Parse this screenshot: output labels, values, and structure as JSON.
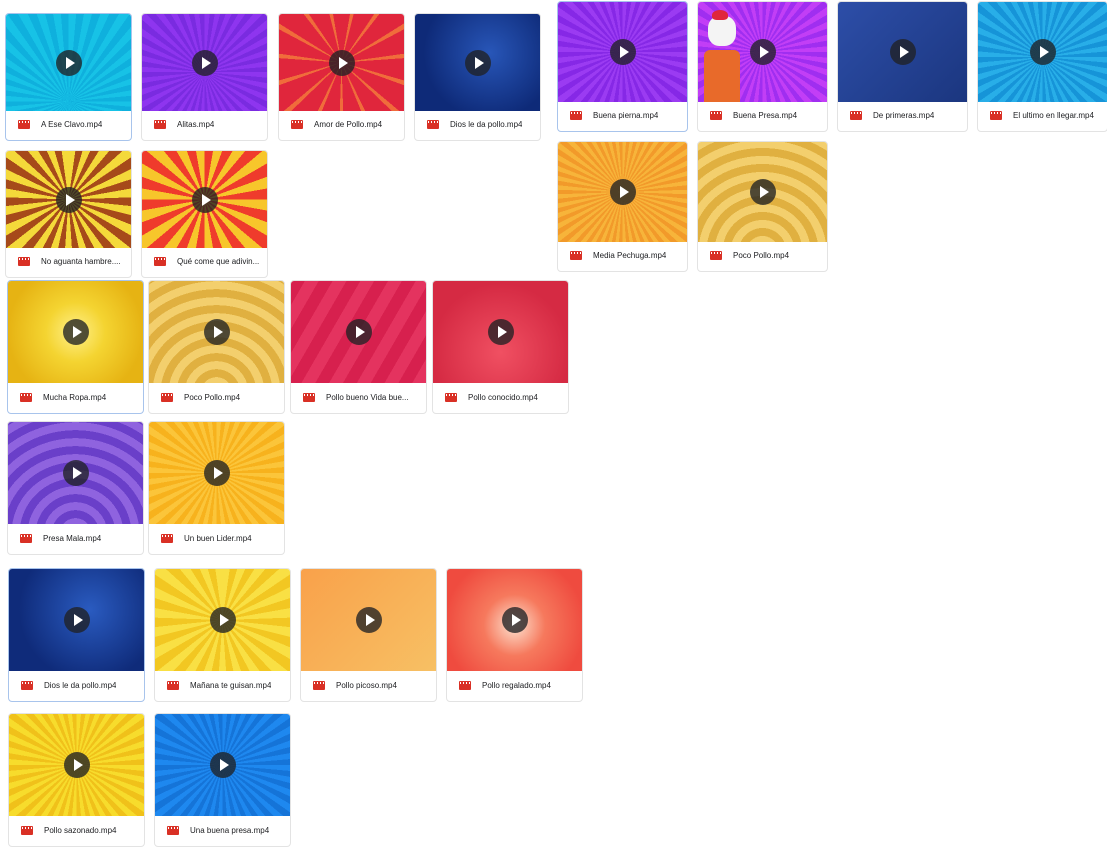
{
  "groups": [
    {
      "files": [
        {
          "name": "A Ese Clavo.mp4",
          "style": "cyan",
          "selected": true
        },
        {
          "name": "Alitas.mp4",
          "style": "purple"
        },
        {
          "name": "Amor de Pollo.mp4",
          "style": "redburst"
        },
        {
          "name": "Dios le da pollo.mp4",
          "style": "navy"
        },
        {
          "name": "No aguanta hambre....",
          "style": "yellowburst"
        },
        {
          "name": "Qué come que adivin...",
          "style": "redyellow"
        }
      ]
    },
    {
      "files": [
        {
          "name": "Buena pierna.mp4",
          "style": "violet",
          "selected": true
        },
        {
          "name": "Buena Presa.mp4",
          "style": "violet2"
        },
        {
          "name": "De primeras.mp4",
          "style": "deepblue"
        },
        {
          "name": "El ultimo en llegar.mp4",
          "style": "skyblue"
        },
        {
          "name": "Media Pechuga.mp4",
          "style": "orange"
        },
        {
          "name": "Poco Pollo.mp4",
          "style": "rings"
        }
      ]
    },
    {
      "files": [
        {
          "name": "Mucha Ropa.mp4",
          "style": "sunyellow",
          "selected": true
        },
        {
          "name": "Poco Pollo.mp4",
          "style": "rings"
        },
        {
          "name": "Pollo bueno Vida bue...",
          "style": "crimson"
        },
        {
          "name": "Pollo conocido.mp4",
          "style": "crimson2"
        },
        {
          "name": "Presa Mala.mp4",
          "style": "violetrings"
        },
        {
          "name": "Un buen Lider.mp4",
          "style": "goldburst"
        }
      ]
    },
    {
      "files": [
        {
          "name": "Dios le da pollo.mp4",
          "style": "navy2",
          "selected": true
        },
        {
          "name": "Mañana te guisan.mp4",
          "style": "zigyellow"
        },
        {
          "name": "Pollo picoso.mp4",
          "style": "peach"
        },
        {
          "name": "Pollo regalado.mp4",
          "style": "coral"
        },
        {
          "name": "Pollo sazonado.mp4",
          "style": "yellowray"
        },
        {
          "name": "Una buena presa.mp4",
          "style": "bluedots"
        }
      ]
    }
  ],
  "icons": {
    "file_type": "video-file-icon",
    "play": "play-icon"
  },
  "colors": {
    "video_icon": "#d93025",
    "selected_border": "#a8c4ec",
    "card_border": "#e3e3e3"
  }
}
